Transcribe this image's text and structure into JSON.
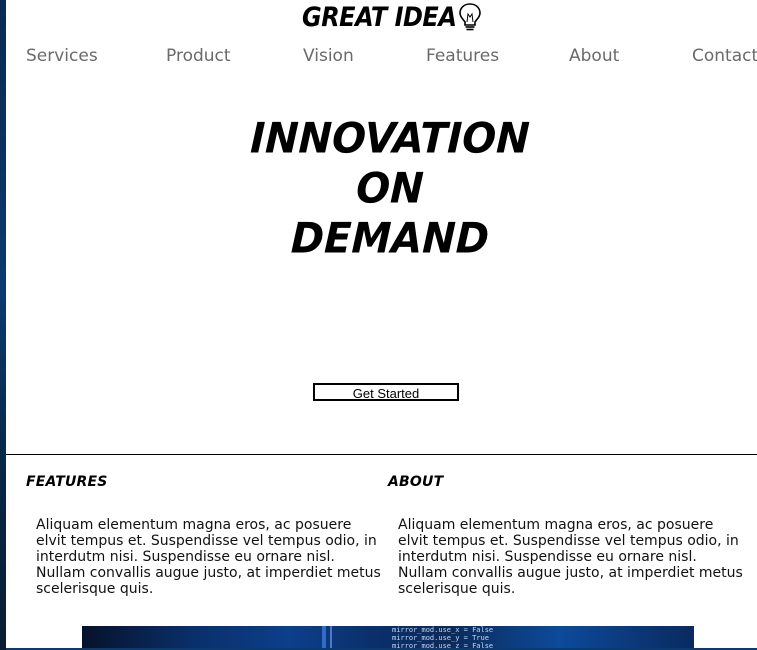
{
  "header": {
    "logo_text": "GREAT IDEA"
  },
  "nav": {
    "items": [
      "Services",
      "Product",
      "Vision",
      "Features",
      "About",
      "Contact"
    ]
  },
  "hero": {
    "lines": [
      "INNOVATION",
      "ON",
      "DEMAND"
    ],
    "cta_label": "Get Started"
  },
  "features": {
    "heading": "FEATURES",
    "body": "Aliquam elementum magna eros, ac posuere elvit tempus et. Suspendisse vel tempus odio, in interdutm nisi. Suspendisse eu ornare nisl. Nullam convallis augue justo, at imperdiet metus scelerisque quis."
  },
  "about": {
    "heading": "ABOUT",
    "body": "Aliquam elementum magna eros, ac posuere elvit tempus et. Suspendisse vel tempus odio, in interdutm nisi. Suspendisse eu ornare nisl. Nullam convallis augue justo, at imperdiet metus scelerisque quis."
  },
  "banner": {
    "code_lines": [
      "mirror_mod.use_x = False",
      "mirror_mod.use_y = True",
      "mirror_mod.use_z = False"
    ]
  },
  "colors": {
    "nav_text": "#6a6a6a",
    "banner_blue": "#0c3f8a"
  },
  "icons": {
    "logo_icon": "lightbulb-icon"
  }
}
